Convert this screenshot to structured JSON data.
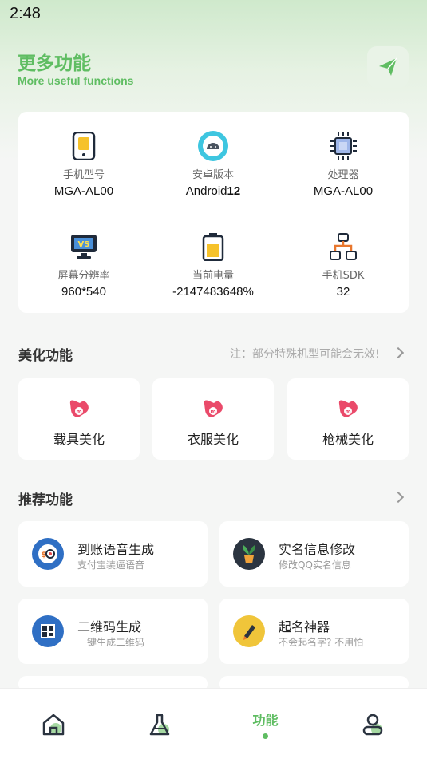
{
  "status_bar": {
    "time": "2:48"
  },
  "header": {
    "title": "更多功能",
    "subtitle": "More useful functions",
    "send_icon": "send-icon"
  },
  "device_info": [
    {
      "label": "手机型号",
      "value": "MGA-AL00",
      "icon": "phone-icon"
    },
    {
      "label": "安卓版本",
      "value_prefix": "Android",
      "value_bold": "12",
      "icon": "android-icon"
    },
    {
      "label": "处理器",
      "value": "MGA-AL00",
      "icon": "cpu-icon"
    },
    {
      "label": "屏幕分辨率",
      "value": "960*540",
      "icon": "screen-icon"
    },
    {
      "label": "当前电量",
      "value": "-2147483648%",
      "icon": "battery-icon"
    },
    {
      "label": "手机SDK",
      "value": "32",
      "icon": "sdk-icon"
    }
  ],
  "beautify": {
    "title": "美化功能",
    "note": "注：部分特殊机型可能会无效!",
    "items": [
      {
        "label": "载具美化",
        "icon": "beautify-icon"
      },
      {
        "label": "衣服美化",
        "icon": "beautify-icon"
      },
      {
        "label": "枪械美化",
        "icon": "beautify-icon"
      }
    ]
  },
  "recommended": {
    "title": "推荐功能",
    "items": [
      {
        "title": "到账语音生成",
        "subtitle": "支付宝装逼语音",
        "icon": "payment-voice-icon"
      },
      {
        "title": "实名信息修改",
        "subtitle": "修改QQ实名信息",
        "icon": "plant-icon"
      },
      {
        "title": "二维码生成",
        "subtitle": "一键生成二维码",
        "icon": "qrcode-icon"
      },
      {
        "title": "起名神器",
        "subtitle": "不会起名字? 不用怕",
        "icon": "pen-icon"
      }
    ]
  },
  "bottom_nav": {
    "items": [
      {
        "name": "home",
        "icon": "home-icon"
      },
      {
        "name": "lab",
        "icon": "flask-icon"
      },
      {
        "name": "functions",
        "label": "功能",
        "active": true
      },
      {
        "name": "profile",
        "icon": "user-icon"
      }
    ]
  },
  "colors": {
    "accent": "#5fbd62",
    "background": "#f5f6f5",
    "card": "#ffffff"
  }
}
